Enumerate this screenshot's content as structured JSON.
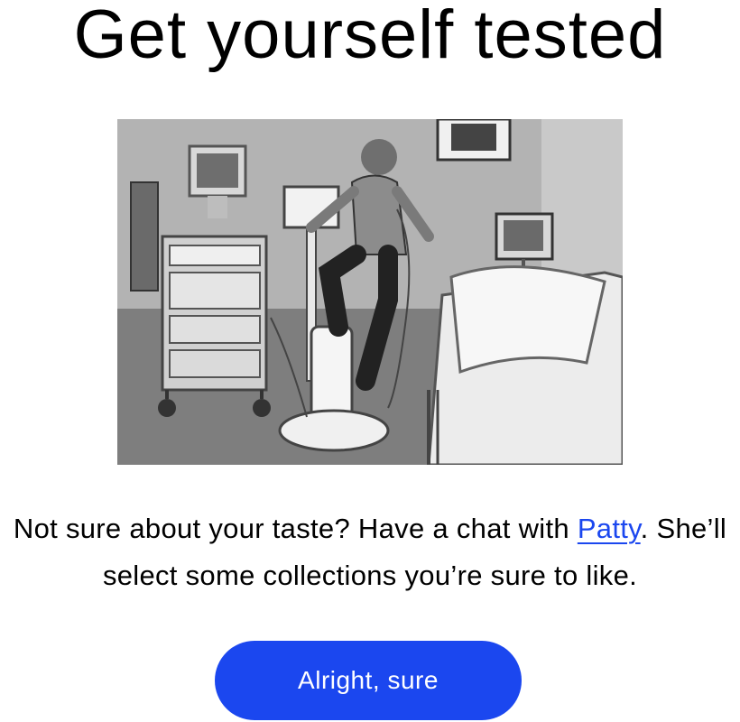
{
  "heading": "Get yourself tested",
  "image": {
    "alt": "Black and white photo of a man on an exercise bike in a medical testing room"
  },
  "message": {
    "before_link": "Not sure about your taste? Have a chat with ",
    "link_text": "Patty",
    "after_link": ". She’ll select some collections you’re sure to like."
  },
  "button": {
    "label": "Alright, sure"
  },
  "colors": {
    "accent": "#1b47ef",
    "text": "#000000",
    "background": "#ffffff"
  }
}
